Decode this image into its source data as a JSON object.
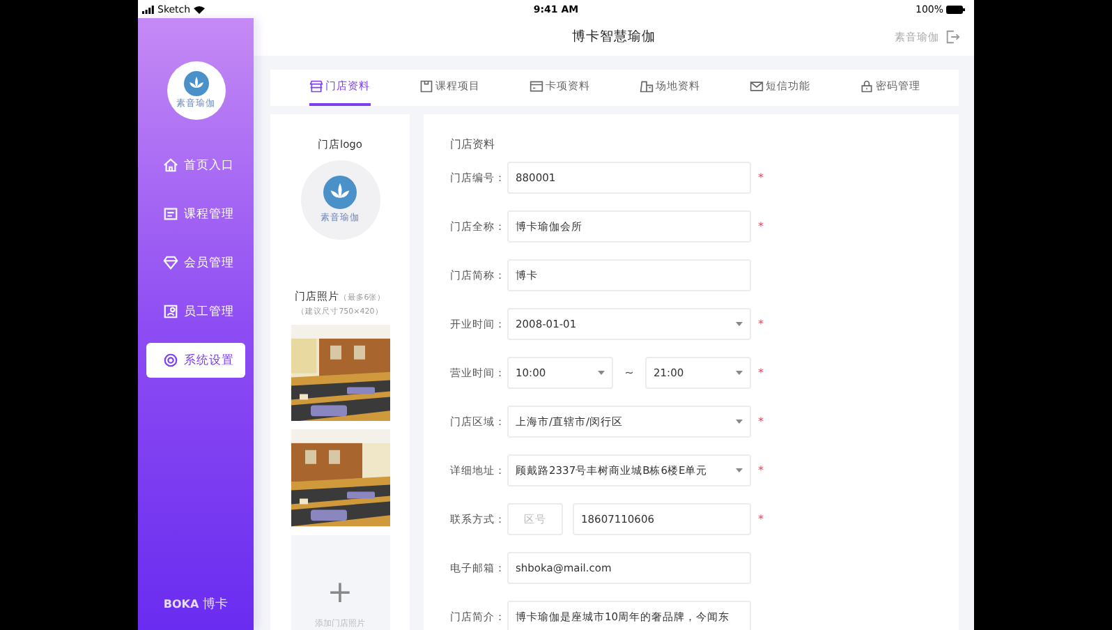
{
  "status_bar": {
    "carrier": "Sketch",
    "time": "9:41 AM",
    "battery": "100%"
  },
  "header": {
    "title": "博卡智慧瑜伽",
    "user": "素音瑜伽"
  },
  "sidebar": {
    "logo_text": "素音瑜伽",
    "items": [
      {
        "label": "首页入口",
        "selected": false
      },
      {
        "label": "课程管理",
        "selected": false
      },
      {
        "label": "会员管理",
        "selected": false
      },
      {
        "label": "员工管理",
        "selected": false
      },
      {
        "label": "系统设置",
        "selected": true
      }
    ],
    "footer_brand": "BOKA",
    "footer_name": "博卡"
  },
  "tabs": [
    {
      "label": "门店资料",
      "selected": true
    },
    {
      "label": "课程项目",
      "selected": false
    },
    {
      "label": "卡项资料",
      "selected": false
    },
    {
      "label": "场地资料",
      "selected": false
    },
    {
      "label": "短信功能",
      "selected": false
    },
    {
      "label": "密码管理",
      "selected": false
    }
  ],
  "store_media": {
    "logo_label": "门店logo",
    "logo_text": "素音瑜伽",
    "photos_label": "门店照片",
    "photos_limit": "（最多6张）",
    "photos_hint": "（建议尺寸750×420）",
    "add_photo": "+",
    "add_photo_label": "添加门店照片"
  },
  "form": {
    "title": "门店资料",
    "fields": [
      {
        "kind": "text",
        "label": "门店编号：",
        "value": "880001",
        "required_mark": "*"
      },
      {
        "kind": "text",
        "label": "门店全称：",
        "value": "博卡瑜伽会所",
        "required_mark": "*"
      },
      {
        "kind": "text",
        "label": "门店简称：",
        "value": "博卡"
      },
      {
        "kind": "select",
        "label": "开业时间：",
        "value": "2008-01-01",
        "required_mark": "*"
      },
      {
        "kind": "range",
        "label": "营业时间：",
        "value": "10:00",
        "separator": "~",
        "value_end": "21:00",
        "required_mark": "*"
      },
      {
        "kind": "select",
        "label": "门店区域：",
        "value": "上海市/直辖市/闵行区",
        "required_mark": "*"
      },
      {
        "kind": "select",
        "label": "详细地址：",
        "value": "顾戴路2337号丰树商业城B栋6楼E单元",
        "required_mark": "*"
      },
      {
        "kind": "phone",
        "label": "联系方式：",
        "placeholder": "区号",
        "value": "18607110606",
        "required_mark": "*"
      },
      {
        "kind": "text",
        "label": "电子邮箱：",
        "value": "shboka@mail.com"
      },
      {
        "kind": "text",
        "label": "门店简介：",
        "value": "博卡瑜伽是座城市10周年的奢品牌，今闻东"
      }
    ]
  }
}
